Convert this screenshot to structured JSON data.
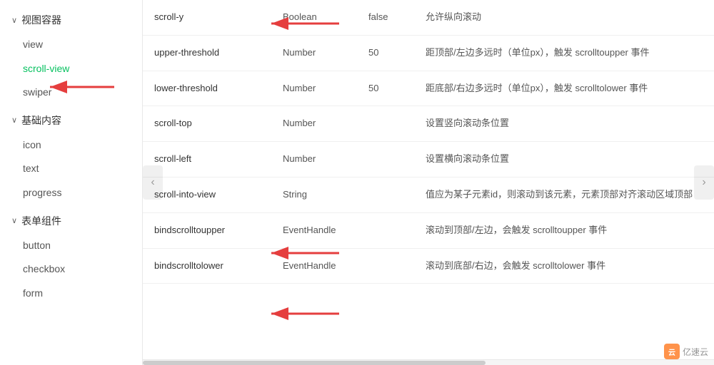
{
  "sidebar": {
    "groups": [
      {
        "id": "view-container",
        "label": "视图容器",
        "expanded": true,
        "items": [
          {
            "id": "view",
            "label": "view",
            "active": false
          },
          {
            "id": "scroll-view",
            "label": "scroll-view",
            "active": true
          },
          {
            "id": "swiper",
            "label": "swiper",
            "active": false
          }
        ]
      },
      {
        "id": "basic-content",
        "label": "基础内容",
        "expanded": true,
        "items": [
          {
            "id": "icon",
            "label": "icon",
            "active": false
          },
          {
            "id": "text",
            "label": "text",
            "active": false
          },
          {
            "id": "progress",
            "label": "progress",
            "active": false
          }
        ]
      },
      {
        "id": "form-components",
        "label": "表单组件",
        "expanded": true,
        "items": [
          {
            "id": "button",
            "label": "button",
            "active": false
          },
          {
            "id": "checkbox",
            "label": "checkbox",
            "active": false
          },
          {
            "id": "form",
            "label": "form",
            "active": false
          }
        ]
      }
    ]
  },
  "table": {
    "rows": [
      {
        "id": "scroll-y",
        "name": "scroll-y",
        "type": "Boolean",
        "default": "false",
        "desc": "允许纵向滚动"
      },
      {
        "id": "upper-threshold",
        "name": "upper-threshold",
        "type": "Number",
        "default": "50",
        "desc": "距顶部/左边多远时（单位px），触发 scrolltoupper 事件"
      },
      {
        "id": "lower-threshold",
        "name": "lower-threshold",
        "type": "Number",
        "default": "50",
        "desc": "距底部/右边多远时（单位px），触发 scrolltolower 事件"
      },
      {
        "id": "scroll-top",
        "name": "scroll-top",
        "type": "Number",
        "default": "",
        "desc": "设置竖向滚动条位置"
      },
      {
        "id": "scroll-left",
        "name": "scroll-left",
        "type": "Number",
        "default": "",
        "desc": "设置横向滚动条位置"
      },
      {
        "id": "scroll-into-view",
        "name": "scroll-into-view",
        "type": "String",
        "default": "",
        "desc": "值应为某子元素id，则滚动到该元素，元素顶部对齐滚动区域顶部"
      },
      {
        "id": "bindscrolltoupper",
        "name": "bindscrolltoupper",
        "type": "EventHandle",
        "default": "",
        "desc": "滚动到顶部/左边，会触发 scrolltoupper 事件"
      },
      {
        "id": "bindscrolltolower",
        "name": "bindscrolltolower",
        "type": "EventHandle",
        "default": "",
        "desc": "滚动到底部/右边，会触发 scrolltolower 事件"
      }
    ]
  },
  "nav": {
    "left_arrow": "‹",
    "right_arrow": "›"
  },
  "watermark": {
    "icon_text": "云",
    "text": "亿速云"
  }
}
